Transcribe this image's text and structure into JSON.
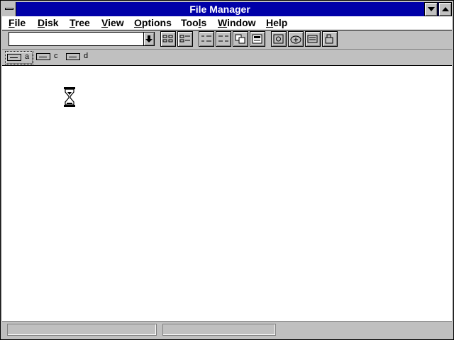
{
  "window": {
    "title": "File Manager"
  },
  "menus": [
    {
      "underline": "F",
      "rest": "ile"
    },
    {
      "underline": "D",
      "rest": "isk"
    },
    {
      "underline": "T",
      "rest": "ree"
    },
    {
      "underline": "V",
      "rest": "iew"
    },
    {
      "underline": "O",
      "rest": "ptions"
    },
    {
      "pre": "Too",
      "underline": "l",
      "rest": "s"
    },
    {
      "underline": "W",
      "rest": "indow"
    },
    {
      "underline": "H",
      "rest": "elp"
    }
  ],
  "toolbar": {
    "drive_combo_value": "",
    "buttons": [
      "connect-network-drive",
      "disconnect-network-drive",
      "view-name-only",
      "view-all-details",
      "sort-by-name",
      "sort-by-type",
      "share-as",
      "stop-sharing",
      "sort-by-size",
      "sort-by-date"
    ]
  },
  "drives": [
    {
      "letter": "a",
      "type": "floppy",
      "selected": true
    },
    {
      "letter": "c",
      "type": "hard-disk",
      "selected": false
    },
    {
      "letter": "d",
      "type": "network",
      "selected": false
    }
  ],
  "cursor": {
    "icon": "hourglass-icon"
  },
  "colors": {
    "title_bar": "#0000a8",
    "chrome": "#c0c0c0",
    "workspace": "#ffffff"
  }
}
